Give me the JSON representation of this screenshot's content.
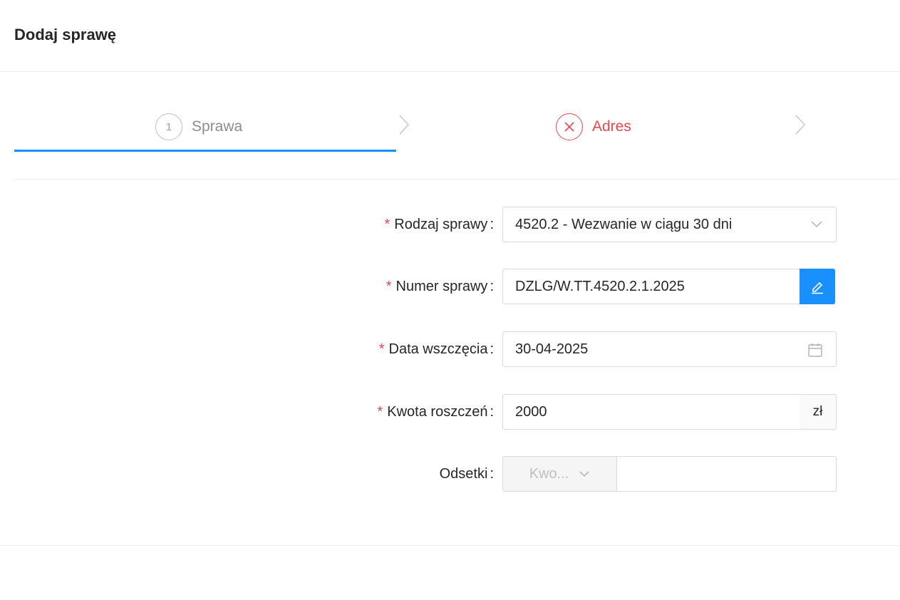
{
  "header": {
    "title": "Dodaj sprawę"
  },
  "steps": [
    {
      "number": "1",
      "label": "Sprawa",
      "status": "active"
    },
    {
      "label": "Adres",
      "status": "error",
      "icon": "close-circle-icon"
    }
  ],
  "form": {
    "rodzaj": {
      "label": "Rodzaj sprawy",
      "value": "4520.2 - Wezwanie w ciągu 30 dni",
      "required": true
    },
    "numer": {
      "label": "Numer sprawy",
      "value": "DZLG/W.TT.4520.2.1.2025",
      "required": true,
      "action_icon": "edit-icon"
    },
    "data": {
      "label": "Data wszczęcia",
      "value": "30-04-2025",
      "required": true,
      "icon": "calendar-icon"
    },
    "kwota": {
      "label": "Kwota roszczeń",
      "value": "2000",
      "suffix": "zł",
      "required": true
    },
    "odsetki": {
      "label": "Odsetki",
      "type_placeholder": "Kwo...",
      "value": "",
      "required": false
    }
  },
  "colors": {
    "primary": "#1890ff",
    "error": "#e5484d",
    "border": "#d9d9d9"
  }
}
